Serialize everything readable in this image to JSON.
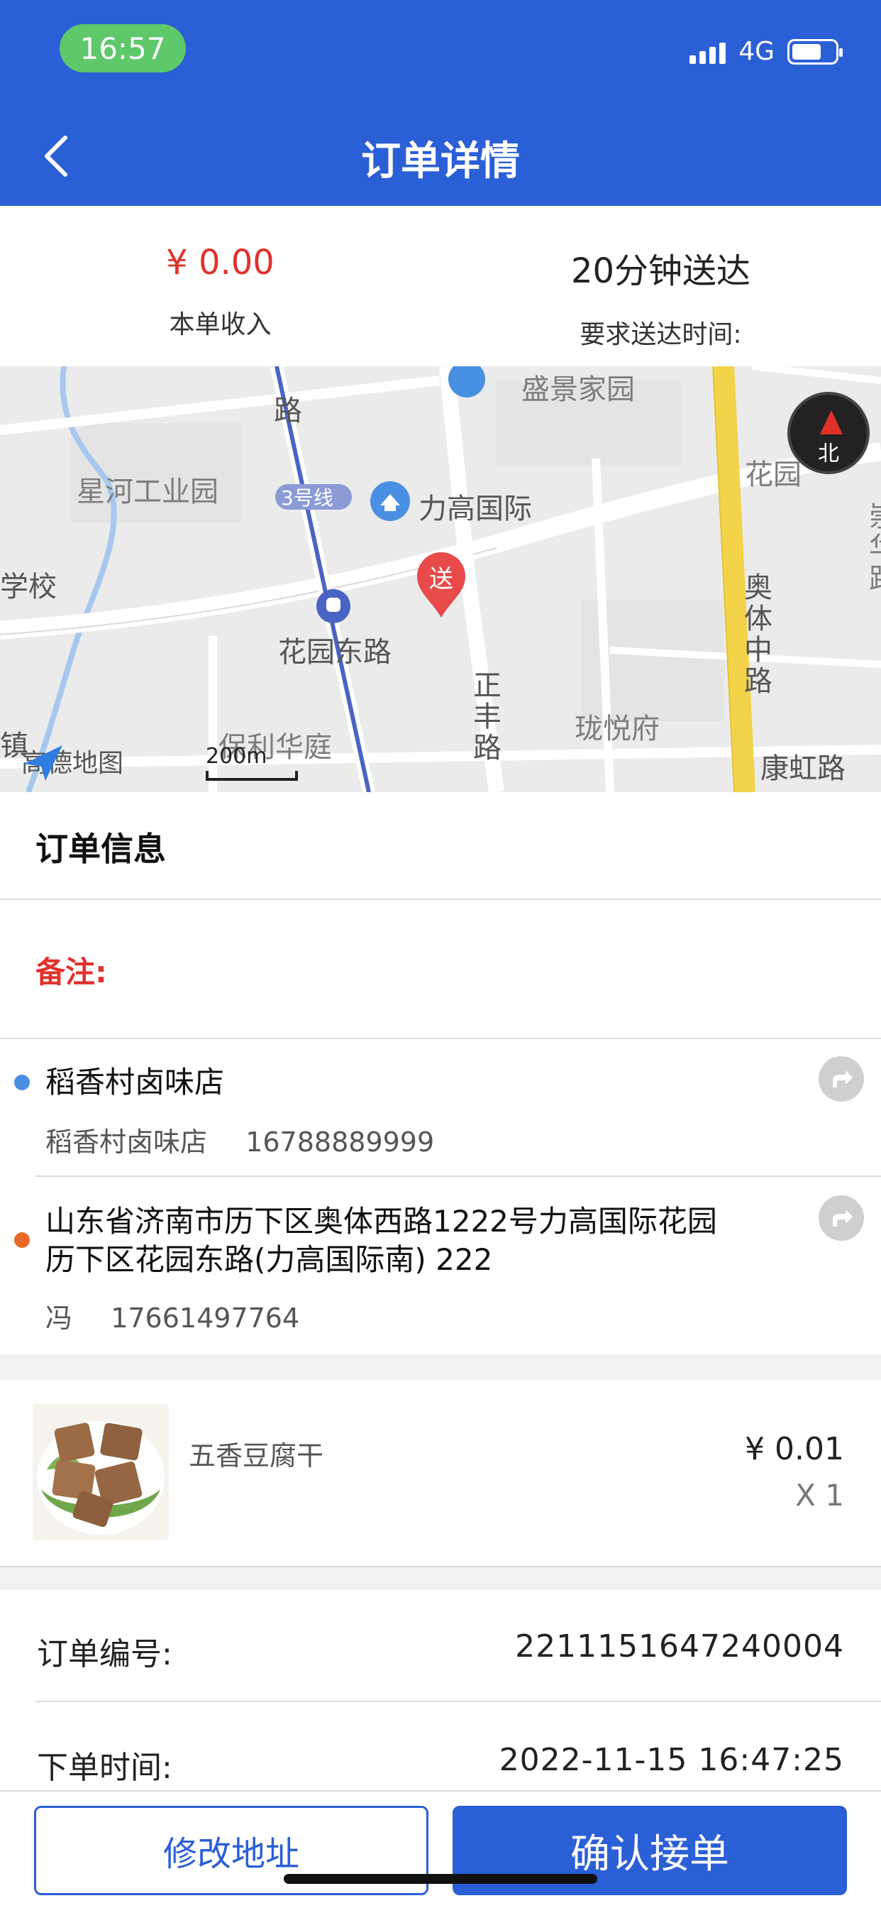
{
  "status_bar": {
    "time": "16:57",
    "network": "4G"
  },
  "header": {
    "title": "订单详情"
  },
  "summary": {
    "income_value": "¥ 0.00",
    "income_label": "本单收入",
    "delivery_value": "20分钟送达",
    "delivery_label": "要求送达时间:"
  },
  "map": {
    "labels": {
      "shengjing": "盛景家园",
      "xinghe": "星河工业园",
      "line3": "3号线",
      "ligao": "力高国际",
      "xuexiao": "学校",
      "huayuan_donglu": "花园东路",
      "huayuan_right": "花园",
      "zhengfeng": "正丰路",
      "longyue": "珑悦府",
      "baoli": "保利华庭",
      "aoti": "奥体中路",
      "kanghong": "康虹路",
      "lu_top": "路",
      "zhen": "镇",
      "chonghua": "崇华路",
      "pin": "送",
      "compass_n": "北",
      "logo": "高德地图",
      "scale": "200m"
    },
    "colors": {
      "road_major": "#f2d34a",
      "metro": "#4a64c4",
      "water": "#a6c8ef",
      "pin": "#e84a4a"
    }
  },
  "order_info": {
    "title": "订单信息",
    "remark_label": "备注:",
    "pickup": {
      "name": "稻香村卤味店",
      "contact": "稻香村卤味店",
      "phone": "16788889999",
      "dot_color": "#4a90e2"
    },
    "dropoff": {
      "address_line1": "山东省济南市历下区奥体西路1222号力高国际花园",
      "address_line2": "历下区花园东路(力高国际南) 222",
      "contact": "冯",
      "phone": "17661497764",
      "dot_color": "#e8682a"
    }
  },
  "product": {
    "name": "五香豆腐干",
    "price": "¥ 0.01",
    "qty": "X 1"
  },
  "details": {
    "order_no_label": "订单编号:",
    "order_no": "2211151647240004",
    "order_time_label": "下单时间:",
    "order_time": "2022-11-15 16:47:25"
  },
  "actions": {
    "modify_address": "修改地址",
    "confirm": "确认接单"
  },
  "theme": {
    "primary": "#2a5fd6",
    "danger": "#e0322b"
  }
}
